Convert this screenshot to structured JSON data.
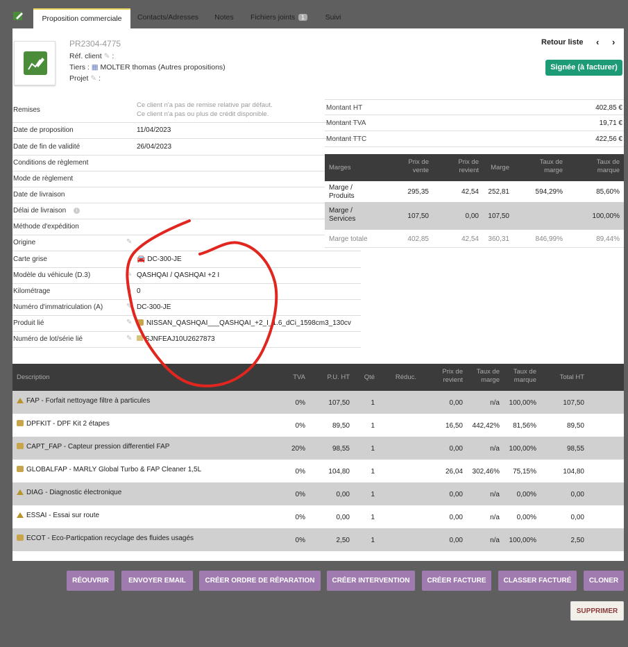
{
  "tabs": [
    {
      "label": "Proposition commerciale"
    },
    {
      "label": "Contacts/Adresses"
    },
    {
      "label": "Notes"
    },
    {
      "label": "Fichiers joints",
      "badge": "1"
    },
    {
      "label": "Suivi"
    }
  ],
  "header": {
    "ref": "PR2304-4775",
    "ref_client_label": "Réf. client",
    "tiers_label": "Tiers :",
    "tiers_value": "MOLTER thomas (Autres propositions)",
    "projet_label": "Projet",
    "retour": "Retour liste",
    "prev": "‹",
    "next": "›",
    "status": "Signée (à facturer)"
  },
  "fields": [
    {
      "label": "Remises",
      "lines": [
        "Ce client n'a pas de remise relative par défaut.",
        "Ce client n'a pas ou plus de crédit disponible."
      ]
    },
    {
      "label": "Date de proposition",
      "value": "11/04/2023"
    },
    {
      "label": "Date de fin de validité",
      "value": "26/04/2023"
    },
    {
      "label": "Conditions de règlement",
      "value": ""
    },
    {
      "label": "Mode de règlement",
      "value": ""
    },
    {
      "label": "Date de livraison",
      "value": ""
    },
    {
      "label": "Délai de livraison",
      "value": ""
    },
    {
      "label": "Méthode d'expédition",
      "value": ""
    },
    {
      "label": "Origine",
      "value": ""
    },
    {
      "label": "Carte grise",
      "value": "DC-300-JE"
    },
    {
      "label": "Modèle du véhicule (D.3)",
      "value": "QASHQAI / QASHQAI +2 I"
    },
    {
      "label": "Kilométrage",
      "value": "0"
    },
    {
      "label": "Numéro d'immatriculation (A)",
      "value": "DC-300-JE"
    },
    {
      "label": "Produit lié",
      "value": "NISSAN_QASHQAI___QASHQAI_+2_I_1.6_dCi_1598cm3_130cv"
    },
    {
      "label": "Numéro de lot/série lié",
      "value": "SJNFEAJ10U2627873"
    }
  ],
  "totals": [
    {
      "label": "Montant HT",
      "value": "402,85 €"
    },
    {
      "label": "Montant TVA",
      "value": "19,71 €"
    },
    {
      "label": "Montant TTC",
      "value": "422,56 €"
    }
  ],
  "margins": {
    "headers": [
      "Marges",
      "Prix de vente",
      "Prix de revient",
      "Marge",
      "Taux de marge",
      "Taux de marque"
    ],
    "rows": [
      {
        "label": "Marge / Produits",
        "vente": "295,35",
        "revient": "42,54",
        "marge": "252,81",
        "taux_marge": "594,29%",
        "taux_marque": "85,60%"
      },
      {
        "label": "Marge / Services",
        "vente": "107,50",
        "revient": "0,00",
        "marge": "107,50",
        "taux_marge": "",
        "taux_marque": "100,00%"
      },
      {
        "label": "Marge totale",
        "vente": "402,85",
        "revient": "42,54",
        "marge": "360,31",
        "taux_marge": "846,99%",
        "taux_marque": "89,44%"
      }
    ]
  },
  "items": {
    "headers": [
      "Description",
      "TVA",
      "P.U. HT",
      "Qté",
      "Réduc.",
      "Prix de revient",
      "Taux de marge",
      "Taux de marque",
      "Total HT"
    ],
    "rows": [
      {
        "type": "service",
        "code": "FAP",
        "desc": " - Forfait nettoyage filtre à particules",
        "tva": "0%",
        "pu": "107,50",
        "qte": "1",
        "revient": "0,00",
        "tmarge": "n/a",
        "tmarque": "100,00%",
        "total": "107,50"
      },
      {
        "type": "product",
        "code": "DPFKIT",
        "desc": " - DPF Kit 2 étapes",
        "tva": "0%",
        "pu": "89,50",
        "qte": "1",
        "revient": "16,50",
        "tmarge": "442,42%",
        "tmarque": "81,56%",
        "total": "89,50"
      },
      {
        "type": "product",
        "code": "CAPT_FAP",
        "desc": " - Capteur pression differentiel FAP",
        "tva": "20%",
        "pu": "98,55",
        "qte": "1",
        "revient": "0,00",
        "tmarge": "n/a",
        "tmarque": "100,00%",
        "total": "98,55"
      },
      {
        "type": "product",
        "code": "GLOBALFAP",
        "desc": " - MARLY Global Turbo & FAP Cleaner 1,5L",
        "tva": "0%",
        "pu": "104,80",
        "qte": "1",
        "revient": "26,04",
        "tmarge": "302,46%",
        "tmarque": "75,15%",
        "total": "104,80"
      },
      {
        "type": "service",
        "code": "DIAG",
        "desc": " - Diagnostic électronique",
        "tva": "0%",
        "pu": "0,00",
        "qte": "1",
        "revient": "0,00",
        "tmarge": "n/a",
        "tmarque": "0,00%",
        "total": "0,00"
      },
      {
        "type": "service",
        "code": "ESSAI",
        "desc": " - Essai sur route",
        "tva": "0%",
        "pu": "0,00",
        "qte": "1",
        "revient": "0,00",
        "tmarge": "n/a",
        "tmarque": "0,00%",
        "total": "0,00"
      },
      {
        "type": "product",
        "code": "ECOT",
        "desc": " - Eco-Particpation recyclage des fluides usagés",
        "tva": "0%",
        "pu": "2,50",
        "qte": "1",
        "revient": "0,00",
        "tmarge": "n/a",
        "tmarque": "100,00%",
        "total": "2,50"
      }
    ]
  },
  "actions": [
    "RÉOUVRIR",
    "ENVOYER EMAIL",
    "CRÉER ORDRE DE RÉPARATION",
    "CRÉER INTERVENTION",
    "CRÉER FACTURE",
    "CLASSER FACTURÉ",
    "CLONER"
  ],
  "delete_label": "SUPPRIMER",
  "colors": {
    "accent": "#9f7bb0",
    "status": "#1d9b76",
    "annotation": "#e0261f"
  }
}
